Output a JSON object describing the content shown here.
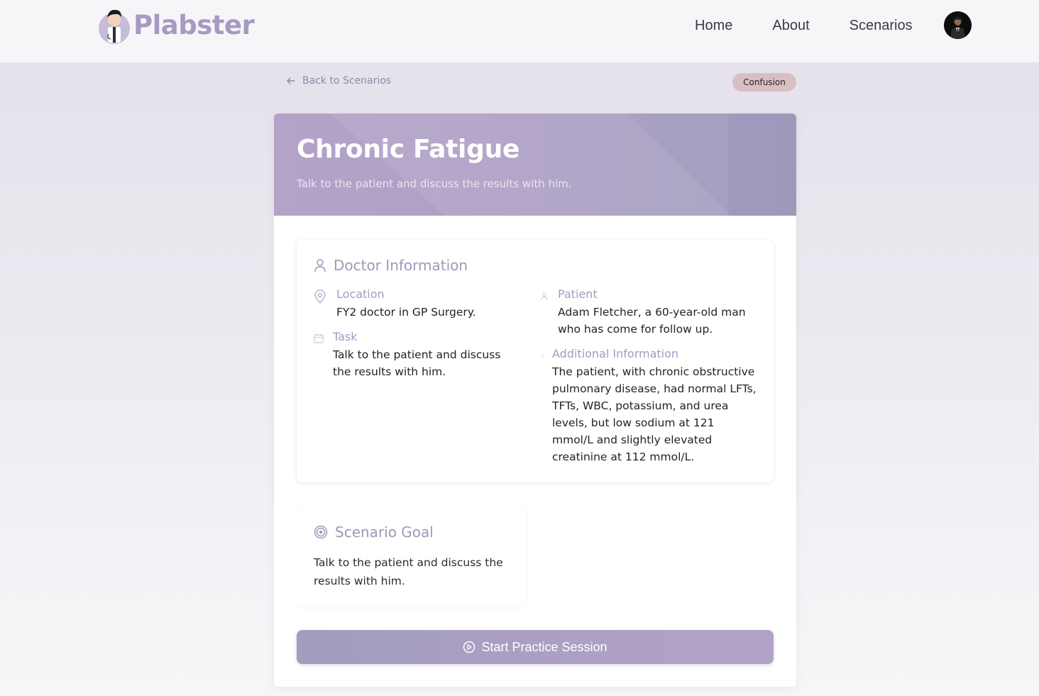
{
  "brand": {
    "name": "Plabster",
    "logo_icon": "doctor-mascot-icon"
  },
  "nav": {
    "items": [
      {
        "label": "Home"
      },
      {
        "label": "About"
      },
      {
        "label": "Scenarios"
      }
    ],
    "avatar_icon": "user-avatar"
  },
  "back_link": {
    "label": "Back to Scenarios",
    "icon": "arrow-left-icon"
  },
  "badge": {
    "label": "Confusion",
    "color": "#d8bfc4"
  },
  "scenario": {
    "title": "Chronic Fatigue",
    "subtitle": "Talk to the patient and discuss the results with him."
  },
  "doctor_info": {
    "title": "Doctor Information",
    "location": {
      "label": "Location",
      "value": "FY2 doctor in GP Surgery."
    },
    "task": {
      "label": "Task",
      "value": "Talk to the patient and discuss the results with him."
    },
    "patient": {
      "label": "Patient",
      "value": "Adam Fletcher, a 60-year-old man who has come for follow up."
    },
    "additional": {
      "label": "Additional Information",
      "value": "The patient, with chronic obstructive pulmonary disease, had normal LFTs, TFTs, WBC, potassium, and urea levels, but low sodium at 121 mmol/L and slightly elevated creatinine at 112 mmol/L."
    }
  },
  "goal": {
    "title": "Scenario Goal",
    "text": "Talk to the patient and discuss the results with him."
  },
  "start_button": {
    "label": "Start Practice Session",
    "icon": "play-circle-icon"
  },
  "colors": {
    "accent": "#a79ac0",
    "hero_start": "#b4a3c8",
    "hero_end": "#a39ebe",
    "label": "#a59bbf"
  }
}
